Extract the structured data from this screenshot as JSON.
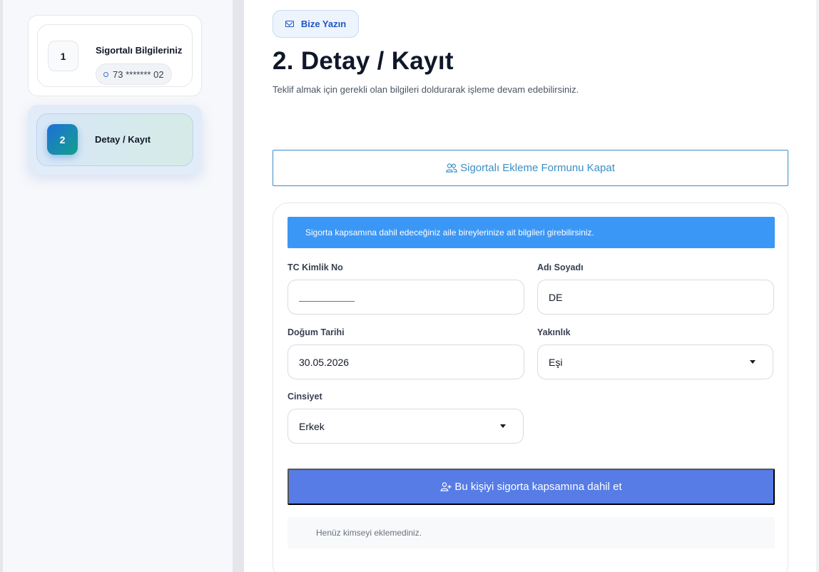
{
  "sidebar": {
    "steps": [
      {
        "number": "1",
        "title": "Sigortalı Bilgileriniz",
        "masked_id": "73 ******* 02"
      },
      {
        "number": "2",
        "title": "Detay / Kayıt"
      }
    ]
  },
  "header": {
    "contact_label": "Bize Yazın",
    "title": "2. Detay / Kayıt",
    "subtitle": "Teklif almak için gerekli olan bilgileri doldurarak işleme devam edebilirsiniz."
  },
  "form": {
    "toggle_label": "Sigortalı Ekleme Formunu Kapat",
    "info_text": "Sigorta kapsamına dahil edeceğiniz aile bireylerinize ait bilgileri girebilirsiniz.",
    "tc_label": "TC Kimlik No",
    "name_label": "Adı Soyadı",
    "name_value": "DE",
    "birth_label": "Doğum Tarihi",
    "birth_value": "30.05.2026",
    "relation_label": "Yakınlık",
    "relation_value": "Eşi",
    "gender_label": "Cinsiyet",
    "gender_value": "Erkek",
    "add_label": "Bu kişiyi sigorta kapsamına dahil et",
    "empty_text": "Henüz kimseyi eklemediniz."
  },
  "colors": {
    "accent": "#3b97f5",
    "primary_button": "#577ce6",
    "outline": "#3a8fc6"
  }
}
